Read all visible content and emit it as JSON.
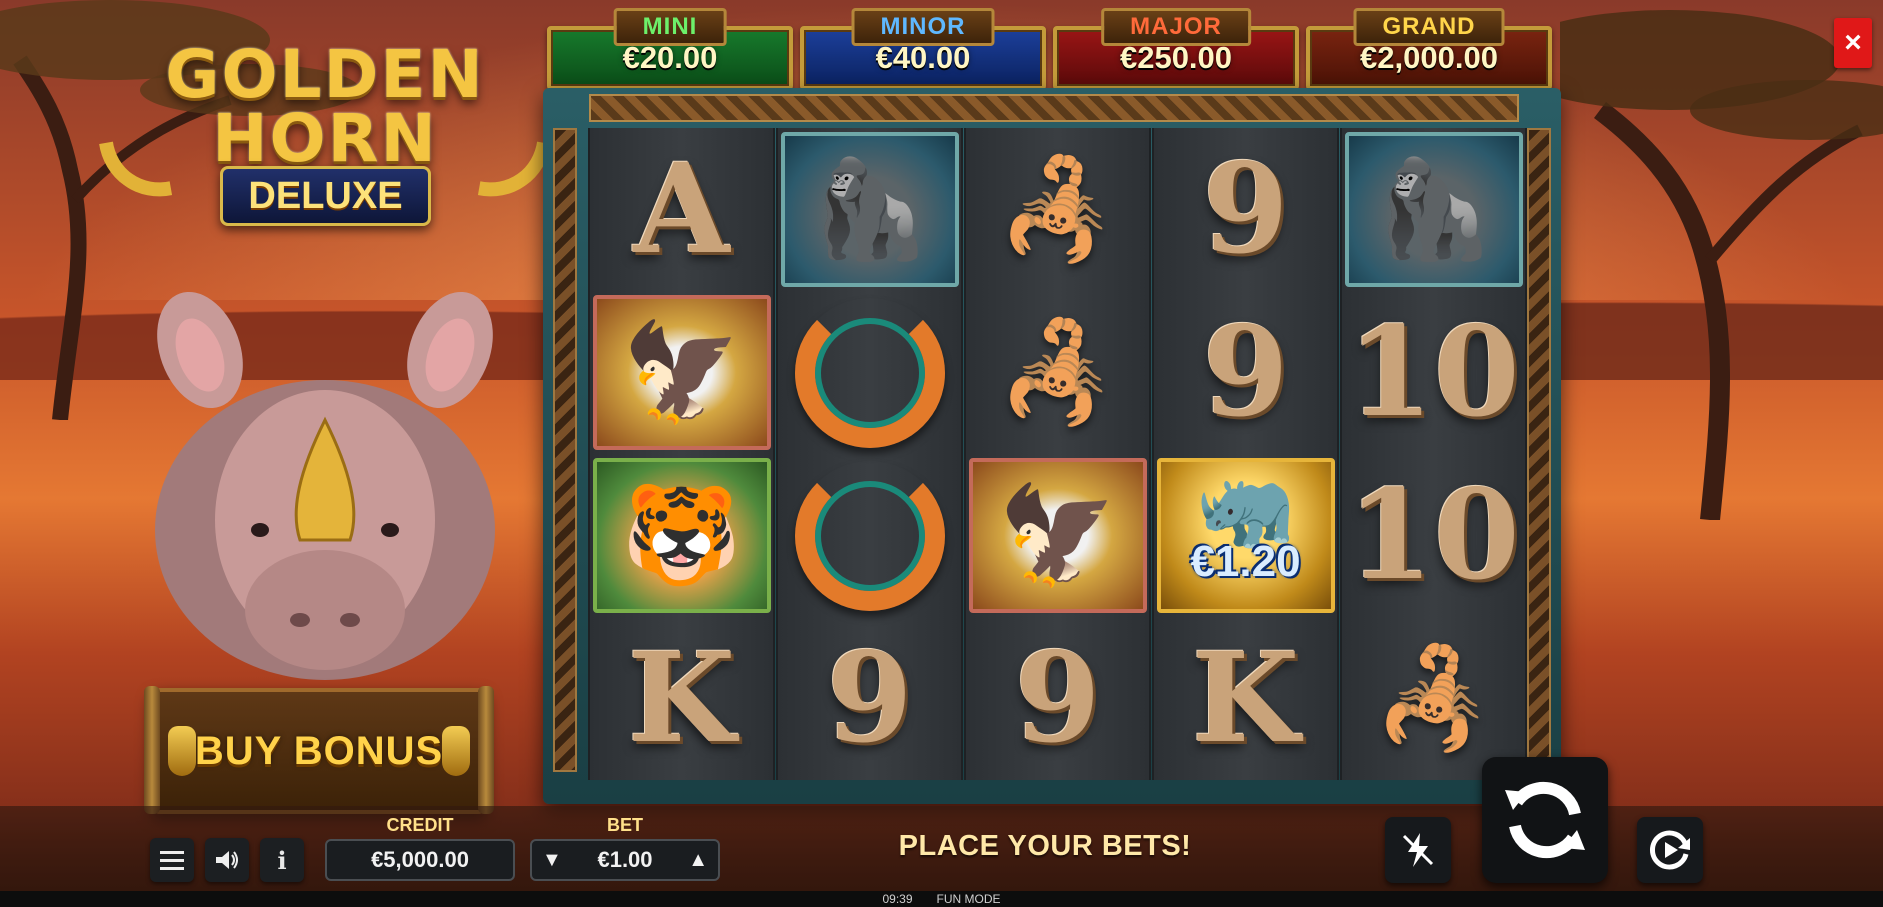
{
  "logo": {
    "line1": "GOLDEN",
    "line2": "HORN",
    "badge": "DELUXE"
  },
  "jackpots": [
    {
      "name": "MINI",
      "value": "€20.00",
      "color": "#177a2c"
    },
    {
      "name": "MINOR",
      "value": "€40.00",
      "color": "#1c3f9a"
    },
    {
      "name": "MAJOR",
      "value": "€250.00",
      "color": "#9a1515"
    },
    {
      "name": "GRAND",
      "value": "€2,000.00",
      "color": "#7a2410"
    }
  ],
  "buy_bonus": {
    "label": "BUY BONUS"
  },
  "close_button": {
    "icon": "close-icon",
    "glyph": "×"
  },
  "reels": [
    [
      "A",
      "eagle",
      "tiger",
      "K"
    ],
    [
      "gorilla",
      "necklace",
      "necklace",
      "9"
    ],
    [
      "scorpion",
      "scorpion",
      "eagle",
      "9"
    ],
    [
      "9",
      "9",
      "gold-rhino",
      "K"
    ],
    [
      "gorilla",
      "10",
      "10",
      "scorpion"
    ]
  ],
  "prize_symbol": {
    "value": "€1.20"
  },
  "controls": {
    "menu_icon": "menu-icon",
    "sound_icon": "speaker-icon",
    "info_icon": "info-icon",
    "credit_label": "CREDIT",
    "credit_value": "€5,000.00",
    "bet_label": "BET",
    "bet_value": "€1.00",
    "status": "PLACE YOUR BETS!",
    "turbo_icon": "lightning-off-icon",
    "spin_icon": "spin-arrows-icon",
    "autoplay_icon": "autoplay-icon"
  },
  "footer": {
    "time": "09:39",
    "mode": "FUN MODE"
  },
  "colors": {
    "accent": "#ffe08a",
    "close": "#e01818"
  }
}
